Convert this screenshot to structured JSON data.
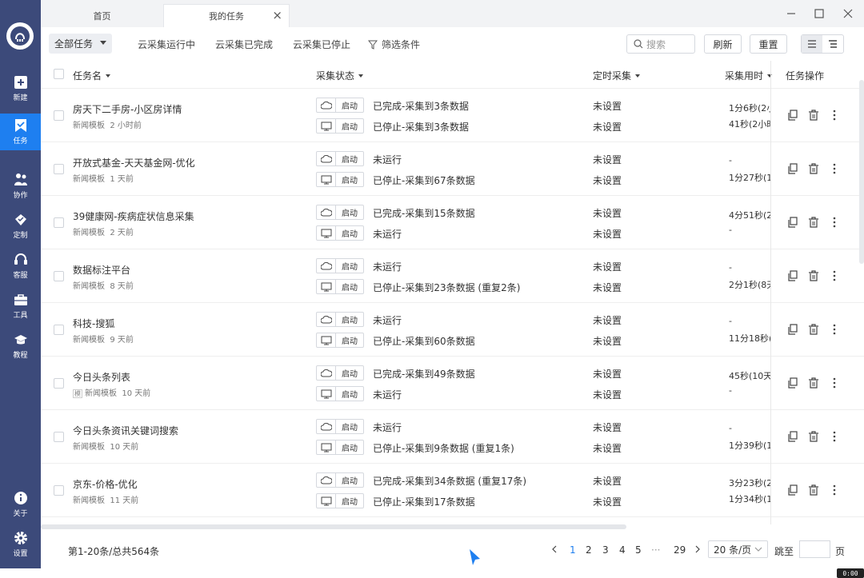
{
  "sidebar": {
    "items": [
      {
        "label": "新建",
        "icon": "new-icon"
      },
      {
        "label": "任务",
        "icon": "task-icon"
      },
      {
        "label": "协作",
        "icon": "collab-icon"
      },
      {
        "label": "定制",
        "icon": "custom-icon"
      },
      {
        "label": "客服",
        "icon": "headset-icon"
      },
      {
        "label": "工具",
        "icon": "toolbox-icon"
      },
      {
        "label": "教程",
        "icon": "tutorial-icon"
      },
      {
        "label": "关于",
        "icon": "info-icon"
      },
      {
        "label": "设置",
        "icon": "gear-icon"
      }
    ]
  },
  "tabs": [
    {
      "label": "首页"
    },
    {
      "label": "我的任务"
    }
  ],
  "toolbar": {
    "filter_all": "全部任务",
    "links": [
      "云采集运行中",
      "云采集已完成",
      "云采集已停止"
    ],
    "filter_cond": "筛选条件",
    "search_placeholder": "搜索",
    "refresh": "刷新",
    "reset": "重置"
  },
  "table": {
    "headers": [
      "任务名",
      "采集状态",
      "定时采集",
      "采集用时",
      "任务操作"
    ],
    "start_label": "启动",
    "rows": [
      {
        "name": "房天下二手房-小区房详情",
        "sub": "新闻模板",
        "time": "2 小时前",
        "s1": "已完成-采集到3条数据",
        "s2": "已停止-采集到3条数据",
        "sc1": "未设置",
        "sc2": "未设置",
        "t1": "1分6秒(2小",
        "t2": "41秒(2小时"
      },
      {
        "name": "开放式基金-天天基金网-优化",
        "sub": "新闻模板",
        "time": "1 天前",
        "s1": "未运行",
        "s2": "已停止-采集到67条数据",
        "sc1": "未设置",
        "sc2": "未设置",
        "t1": "-",
        "t2": "1分27秒(1"
      },
      {
        "name": "39健康网-疾病症状信息采集",
        "sub": "新闻模板",
        "time": "2 天前",
        "s1": "已完成-采集到15条数据",
        "s2": "未运行",
        "sc1": "未设置",
        "sc2": "未设置",
        "t1": "4分51秒(2",
        "t2": "-"
      },
      {
        "name": "数据标注平台",
        "sub": "新闻模板",
        "time": "8 天前",
        "s1": "未运行",
        "s2": "已停止-采集到23条数据 (重复2条)",
        "sc1": "未设置",
        "sc2": "未设置",
        "t1": "-",
        "t2": "2分1秒(8天"
      },
      {
        "name": "科技-搜狐",
        "sub": "新闻模板",
        "time": "9 天前",
        "s1": "未运行",
        "s2": "已停止-采集到60条数据",
        "sc1": "未设置",
        "sc2": "未设置",
        "t1": "-",
        "t2": "11分18秒("
      },
      {
        "name": "今日头条列表",
        "sub": "新闻模板",
        "time": "10 天前",
        "s1": "已完成-采集到49条数据",
        "s2": "未运行",
        "sc1": "未设置",
        "sc2": "未设置",
        "t1": "45秒(10天",
        "t2": "-",
        "sub_icon": "模"
      },
      {
        "name": "今日头条资讯关键词搜索",
        "sub": "新闻模板",
        "time": "10 天前",
        "s1": "未运行",
        "s2": "已停止-采集到9条数据 (重复1条)",
        "sc1": "未设置",
        "sc2": "未设置",
        "t1": "-",
        "t2": "1分39秒(1"
      },
      {
        "name": "京东-价格-优化",
        "sub": "新闻模板",
        "time": "11 天前",
        "s1": "已完成-采集到34条数据 (重复17条)",
        "s2": "已停止-采集到17条数据",
        "sc1": "未设置",
        "sc2": "未设置",
        "t1": "3分23秒(2",
        "t2": "1分34秒(1"
      }
    ]
  },
  "footer": {
    "total": "第1-20条/总共564条",
    "pages": [
      "1",
      "2",
      "3",
      "4",
      "5",
      "···",
      "29"
    ],
    "current_page": "1",
    "page_size": "20 条/页",
    "jump": "跳至",
    "page_unit": "页"
  },
  "badge": "0:00",
  "colors": {
    "sidebar": "#3c4a7a",
    "accent": "#1e7ff0"
  }
}
